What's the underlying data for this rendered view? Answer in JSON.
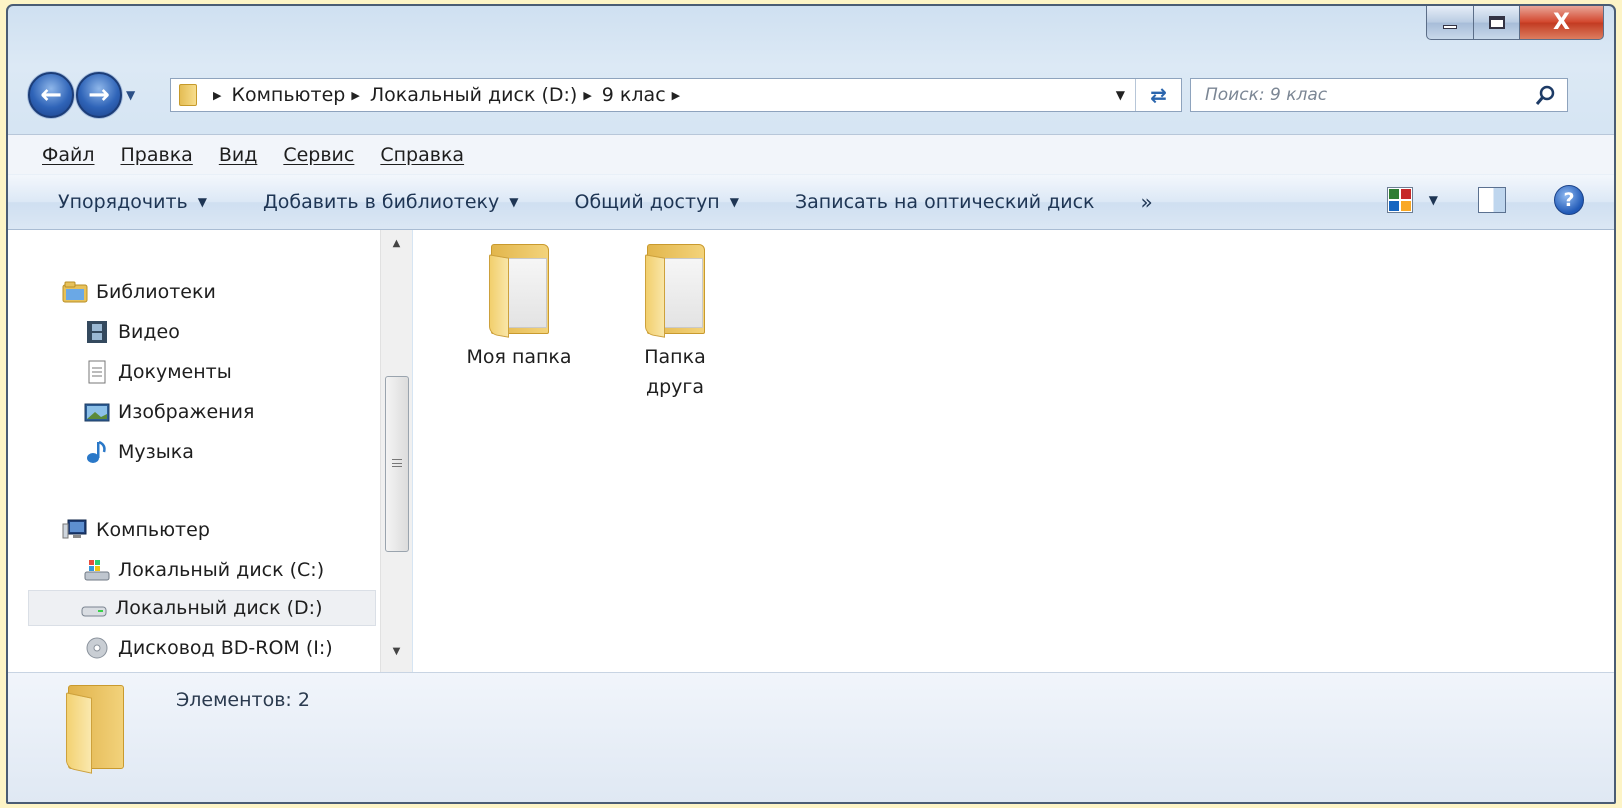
{
  "window": {
    "caption_buttons": {
      "close": "X"
    }
  },
  "address": {
    "crumbs": [
      "Компьютер",
      "Локальный диск (D:)",
      "9 клас"
    ]
  },
  "search": {
    "placeholder": "Поиск: 9 клас"
  },
  "menu": [
    "Файл",
    "Правка",
    "Вид",
    "Сервис",
    "Справка"
  ],
  "commands": [
    "Упорядочить",
    "Добавить в библиотеку",
    "Общий доступ",
    "Записать на оптический диск"
  ],
  "commands_more": "»",
  "help_glyph": "?",
  "nav": {
    "libraries": {
      "label": "Библиотеки",
      "icon": "libraries-icon"
    },
    "library_items": [
      {
        "label": "Видео",
        "icon": "video-icon"
      },
      {
        "label": "Документы",
        "icon": "documents-icon"
      },
      {
        "label": "Изображения",
        "icon": "pictures-icon"
      },
      {
        "label": "Музыка",
        "icon": "music-icon"
      }
    ],
    "computer": {
      "label": "Компьютер",
      "icon": "computer-icon"
    },
    "drives": [
      {
        "label": "Локальный диск (C:)",
        "icon": "system-drive-icon"
      },
      {
        "label": "Локальный диск (D:)",
        "icon": "hard-drive-icon",
        "selected": true
      },
      {
        "label": "Дисковод BD-ROM (I:)",
        "icon": "optical-drive-icon"
      }
    ]
  },
  "content": {
    "folders": [
      {
        "label": "Моя папка"
      },
      {
        "label": "Папка друга"
      }
    ]
  },
  "details": {
    "text": "Элементов: 2"
  },
  "colors": {
    "page_background": "#FDF4C6",
    "window_frame": "#D6E5F3",
    "close_button": "#C8432A",
    "folder": "#F2D27B",
    "selection": "#EEF0F3"
  }
}
